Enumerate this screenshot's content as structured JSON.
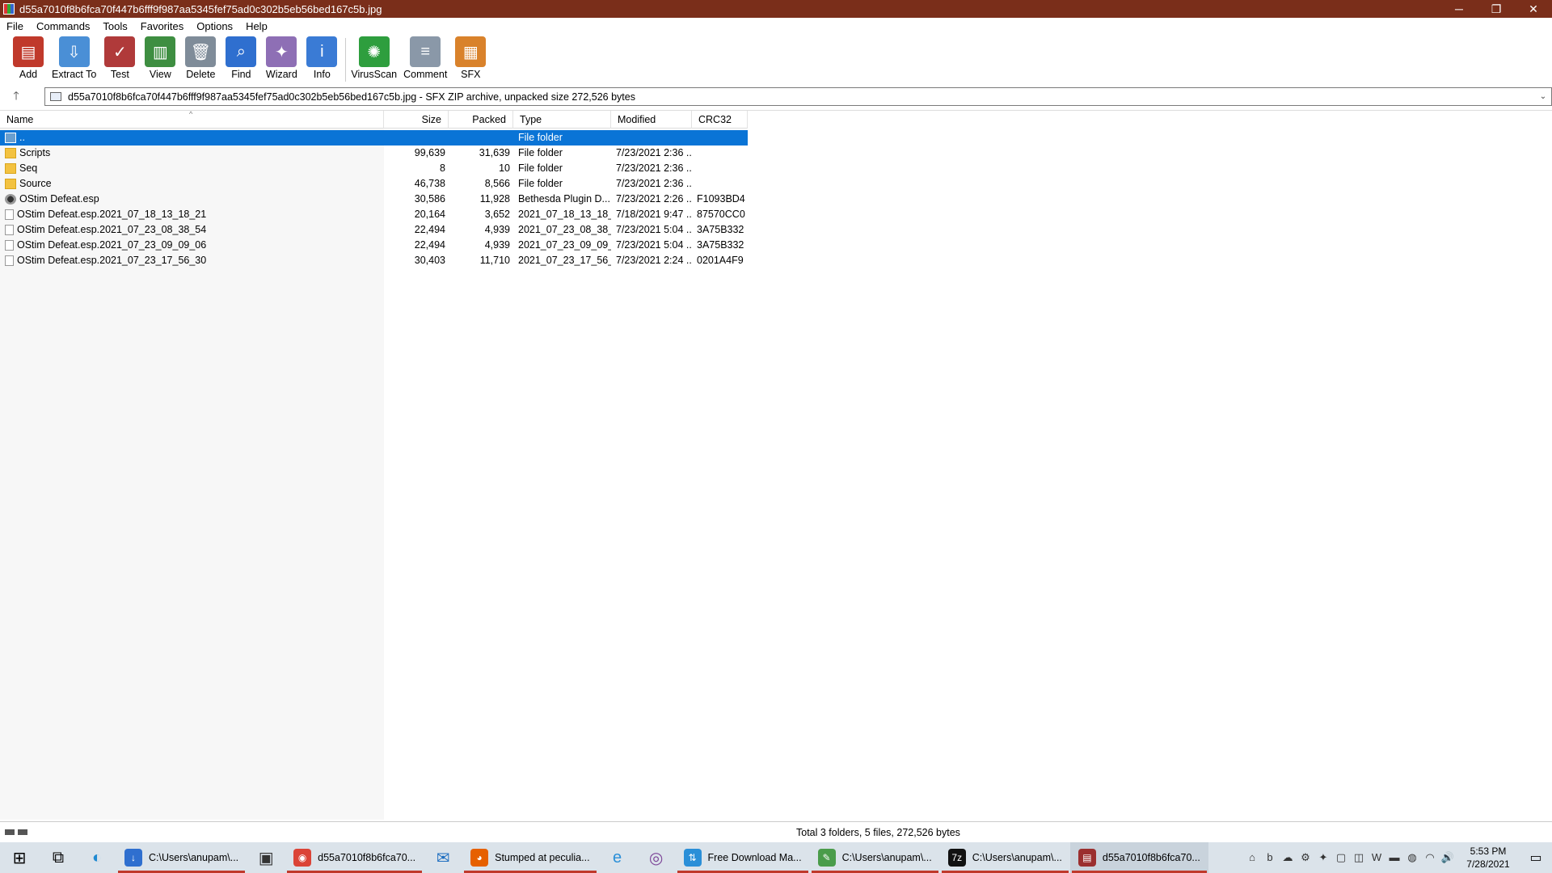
{
  "window": {
    "title": "d55a7010f8b6fca70f447b6fff9f987aa5345fef75ad0c302b5eb56bed167c5b.jpg",
    "minimize": "─",
    "restore": "❐",
    "close": "✕"
  },
  "menu": [
    "File",
    "Commands",
    "Tools",
    "Favorites",
    "Options",
    "Help"
  ],
  "toolbar": [
    {
      "label": "Add",
      "icon": "add-books-icon",
      "color": "#c0392b",
      "glyph": "▤"
    },
    {
      "label": "Extract To",
      "icon": "folder-extract-icon",
      "color": "#4a8fd6",
      "glyph": "⇩"
    },
    {
      "label": "Test",
      "icon": "clipboard-test-icon",
      "color": "#b03a3a",
      "glyph": "✓"
    },
    {
      "label": "View",
      "icon": "book-view-icon",
      "color": "#3e8e41",
      "glyph": "▥"
    },
    {
      "label": "Delete",
      "icon": "trash-icon",
      "color": "#7f8c99",
      "glyph": "🗑"
    },
    {
      "label": "Find",
      "icon": "magnifier-icon",
      "color": "#2f6fcf",
      "glyph": "⌕"
    },
    {
      "label": "Wizard",
      "icon": "wand-icon",
      "color": "#8e6fb5",
      "glyph": "✦"
    },
    {
      "label": "Info",
      "icon": "info-icon",
      "color": "#3a7bd5",
      "glyph": "i"
    },
    {
      "label": "VirusScan",
      "icon": "virus-scan-icon",
      "color": "#2e9e3e",
      "glyph": "✺"
    },
    {
      "label": "Comment",
      "icon": "comment-icon",
      "color": "#8a98a8",
      "glyph": "≡"
    },
    {
      "label": "SFX",
      "icon": "sfx-box-icon",
      "color": "#d9822b",
      "glyph": "▦"
    }
  ],
  "address": {
    "up_glyph": "🡑",
    "text": "d55a7010f8b6fca70f447b6fff9f987aa5345fef75ad0c302b5eb56bed167c5b.jpg - SFX ZIP archive, unpacked size 272,526 bytes",
    "chevron": "⌄"
  },
  "columns": {
    "name": "Name",
    "size": "Size",
    "packed": "Packed",
    "type": "Type",
    "modified": "Modified",
    "crc": "CRC32",
    "sort_caret": "^"
  },
  "rows": [
    {
      "kind": "up",
      "name": "..",
      "size": "",
      "packed": "",
      "type": "File folder",
      "modified": "",
      "crc": ""
    },
    {
      "kind": "folder",
      "name": "Scripts",
      "size": "99,639",
      "packed": "31,639",
      "type": "File folder",
      "modified": "7/23/2021 2:36 ...",
      "crc": ""
    },
    {
      "kind": "folder",
      "name": "Seq",
      "size": "8",
      "packed": "10",
      "type": "File folder",
      "modified": "7/23/2021 2:36 ...",
      "crc": ""
    },
    {
      "kind": "folder",
      "name": "Source",
      "size": "46,738",
      "packed": "8,566",
      "type": "File folder",
      "modified": "7/23/2021 2:36 ...",
      "crc": ""
    },
    {
      "kind": "plugin",
      "name": "OStim Defeat.esp",
      "size": "30,586",
      "packed": "11,928",
      "type": "Bethesda Plugin D...",
      "modified": "7/23/2021 2:26 ...",
      "crc": "F1093BD4"
    },
    {
      "kind": "file",
      "name": "OStim Defeat.esp.2021_07_18_13_18_21",
      "size": "20,164",
      "packed": "3,652",
      "type": "2021_07_18_13_18_...",
      "modified": "7/18/2021 9:47 ...",
      "crc": "87570CC0"
    },
    {
      "kind": "file",
      "name": "OStim Defeat.esp.2021_07_23_08_38_54",
      "size": "22,494",
      "packed": "4,939",
      "type": "2021_07_23_08_38_...",
      "modified": "7/23/2021 5:04 ...",
      "crc": "3A75B332"
    },
    {
      "kind": "file",
      "name": "OStim Defeat.esp.2021_07_23_09_09_06",
      "size": "22,494",
      "packed": "4,939",
      "type": "2021_07_23_09_09_...",
      "modified": "7/23/2021 5:04 ...",
      "crc": "3A75B332"
    },
    {
      "kind": "file",
      "name": "OStim Defeat.esp.2021_07_23_17_56_30",
      "size": "30,403",
      "packed": "11,710",
      "type": "2021_07_23_17_56_...",
      "modified": "7/23/2021 2:24 ...",
      "crc": "0201A4F9"
    }
  ],
  "status": {
    "text": "Total 3 folders, 5 files, 272,526 bytes"
  },
  "taskbar": {
    "start_glyph": "⊞",
    "taskview_glyph": "⧉",
    "tasks": [
      {
        "label": "C:\\Users\\anupam\\...",
        "icon": "download-arrow-icon",
        "color": "#2f6fcf",
        "glyph": "↓",
        "active": false
      },
      {
        "label": "",
        "icon": "store-bag-icon",
        "color": "#333",
        "glyph": "▣",
        "active": false
      },
      {
        "label": "d55a7010f8b6fca70...",
        "icon": "chrome-icon",
        "color": "#db4437",
        "glyph": "◉",
        "active": false
      },
      {
        "label": "",
        "icon": "mail-icon",
        "color": "#1f6fc0",
        "glyph": "✉",
        "active": false
      },
      {
        "label": "Stumped at peculia...",
        "icon": "firefox-icon",
        "color": "#e66000",
        "glyph": "◕",
        "active": false
      },
      {
        "label": "",
        "icon": "ie-icon",
        "color": "#2a8fd8",
        "glyph": "e",
        "active": false
      },
      {
        "label": "",
        "icon": "tor-icon",
        "color": "#7d4698",
        "glyph": "◎",
        "active": false
      },
      {
        "label": "Free Download Ma...",
        "icon": "fdm-icon",
        "color": "#2a8fd8",
        "glyph": "⇅",
        "active": false
      },
      {
        "label": "C:\\Users\\anupam\\...",
        "icon": "notepad-icon",
        "color": "#4a9c4a",
        "glyph": "✎",
        "active": false
      },
      {
        "label": "C:\\Users\\anupam\\...",
        "icon": "7zip-icon",
        "color": "#111",
        "glyph": "7z",
        "active": false
      },
      {
        "label": "d55a7010f8b6fca70...",
        "icon": "winrar-icon",
        "color": "#9b2f2f",
        "glyph": "▤",
        "active": true
      }
    ],
    "tray": [
      "⌂",
      "b",
      "☁",
      "⚙",
      "✦",
      "▢",
      "◫",
      "W",
      "▬",
      "◍",
      "◠",
      "🔊"
    ],
    "time": "5:53 PM",
    "date": "7/28/2021",
    "notif_glyph": "▭"
  }
}
